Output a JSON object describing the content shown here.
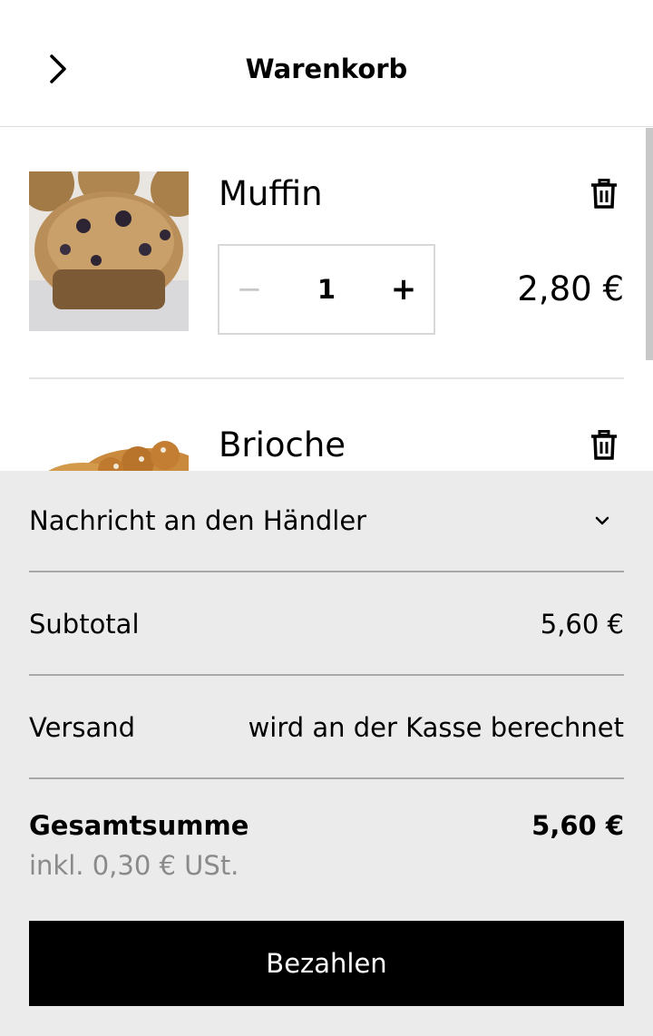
{
  "header": {
    "title": "Warenkorb",
    "back_icon": "chevron-right-icon"
  },
  "cart": {
    "items": [
      {
        "name": "Muffin",
        "image": "muffin-photo",
        "quantity": "1",
        "minus": "−",
        "plus": "+",
        "price": "2,80 €",
        "remove_icon": "trash-icon"
      },
      {
        "name": "Brioche",
        "image": "brioche-photo",
        "remove_icon": "trash-icon"
      }
    ]
  },
  "summary": {
    "message_label": "Nachricht an den Händler",
    "subtotal_label": "Subtotal",
    "subtotal_value": "5,60 €",
    "shipping_label": "Versand",
    "shipping_value": "wird an der Kasse berechnet",
    "total_label": "Gesamtsumme",
    "total_value": "5,60 €",
    "tax_note": "inkl. 0,30 € USt.",
    "pay_label": "Bezahlen"
  },
  "colors": {
    "summary_bg": "#ebebeb",
    "pay_button_bg": "#000000",
    "muted_text": "#8a8a8a"
  }
}
